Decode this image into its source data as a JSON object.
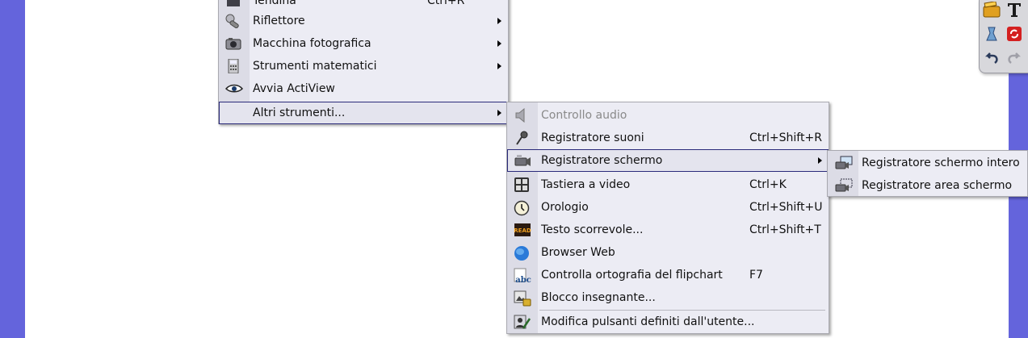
{
  "colors": {
    "background": "#6464dc",
    "canvas": "#ffffff",
    "menu_bg": "#ececf4",
    "highlight_border": "#2a2a7a"
  },
  "toolbar": {
    "icons": [
      "clapperboard-icon",
      "text-tool-icon",
      "reveal-icon",
      "refresh-icon",
      "undo-icon",
      "redo-icon"
    ]
  },
  "menu_main": {
    "items": [
      {
        "label": "Tendina",
        "shortcut": "Ctrl+R",
        "icon": "curtain-icon",
        "submenu": false
      },
      {
        "label": "Riflettore",
        "icon": "spotlight-icon",
        "submenu": true
      },
      {
        "label": "Macchina fotografica",
        "icon": "camera-icon",
        "submenu": true
      },
      {
        "label": "Strumenti matematici",
        "icon": "calculator-icon",
        "submenu": true
      },
      {
        "label": "Avvia ActiView",
        "icon": "eye-icon",
        "submenu": false
      },
      {
        "label": "Altri strumenti...",
        "icon": "",
        "submenu": true,
        "highlighted": true
      }
    ]
  },
  "menu_other_tools": {
    "items": [
      {
        "label": "Controllo audio",
        "shortcut": "",
        "icon": "speaker-icon",
        "disabled": true
      },
      {
        "label": "Registratore suoni",
        "shortcut": "Ctrl+Shift+R",
        "icon": "microphone-icon"
      },
      {
        "label": "Registratore schermo",
        "shortcut": "",
        "icon": "video-camera-icon",
        "submenu": true,
        "highlighted": true
      },
      {
        "label": "Tastiera a video",
        "shortcut": "Ctrl+K",
        "icon": "keyboard-icon"
      },
      {
        "label": "Orologio",
        "shortcut": "Ctrl+Shift+U",
        "icon": "clock-icon"
      },
      {
        "label": "Testo scorrevole...",
        "shortcut": "Ctrl+Shift+T",
        "icon": "ticker-icon",
        "badge": "READ"
      },
      {
        "label": "Browser Web",
        "shortcut": "",
        "icon": "globe-icon"
      },
      {
        "label": "Controlla ortografia del flipchart",
        "shortcut": "F7",
        "icon": "spellcheck-icon",
        "badge": "abc"
      },
      {
        "label": "Blocco insegnante...",
        "shortcut": "",
        "icon": "teacher-lock-icon"
      },
      {
        "label": "Modifica pulsanti definiti dall'utente...",
        "shortcut": "",
        "icon": "edit-user-buttons-icon"
      }
    ]
  },
  "menu_screen_recorder": {
    "items": [
      {
        "label": "Registratore schermo intero",
        "icon": "full-screen-recorder-icon"
      },
      {
        "label": "Registratore area schermo",
        "icon": "area-screen-recorder-icon"
      }
    ]
  }
}
